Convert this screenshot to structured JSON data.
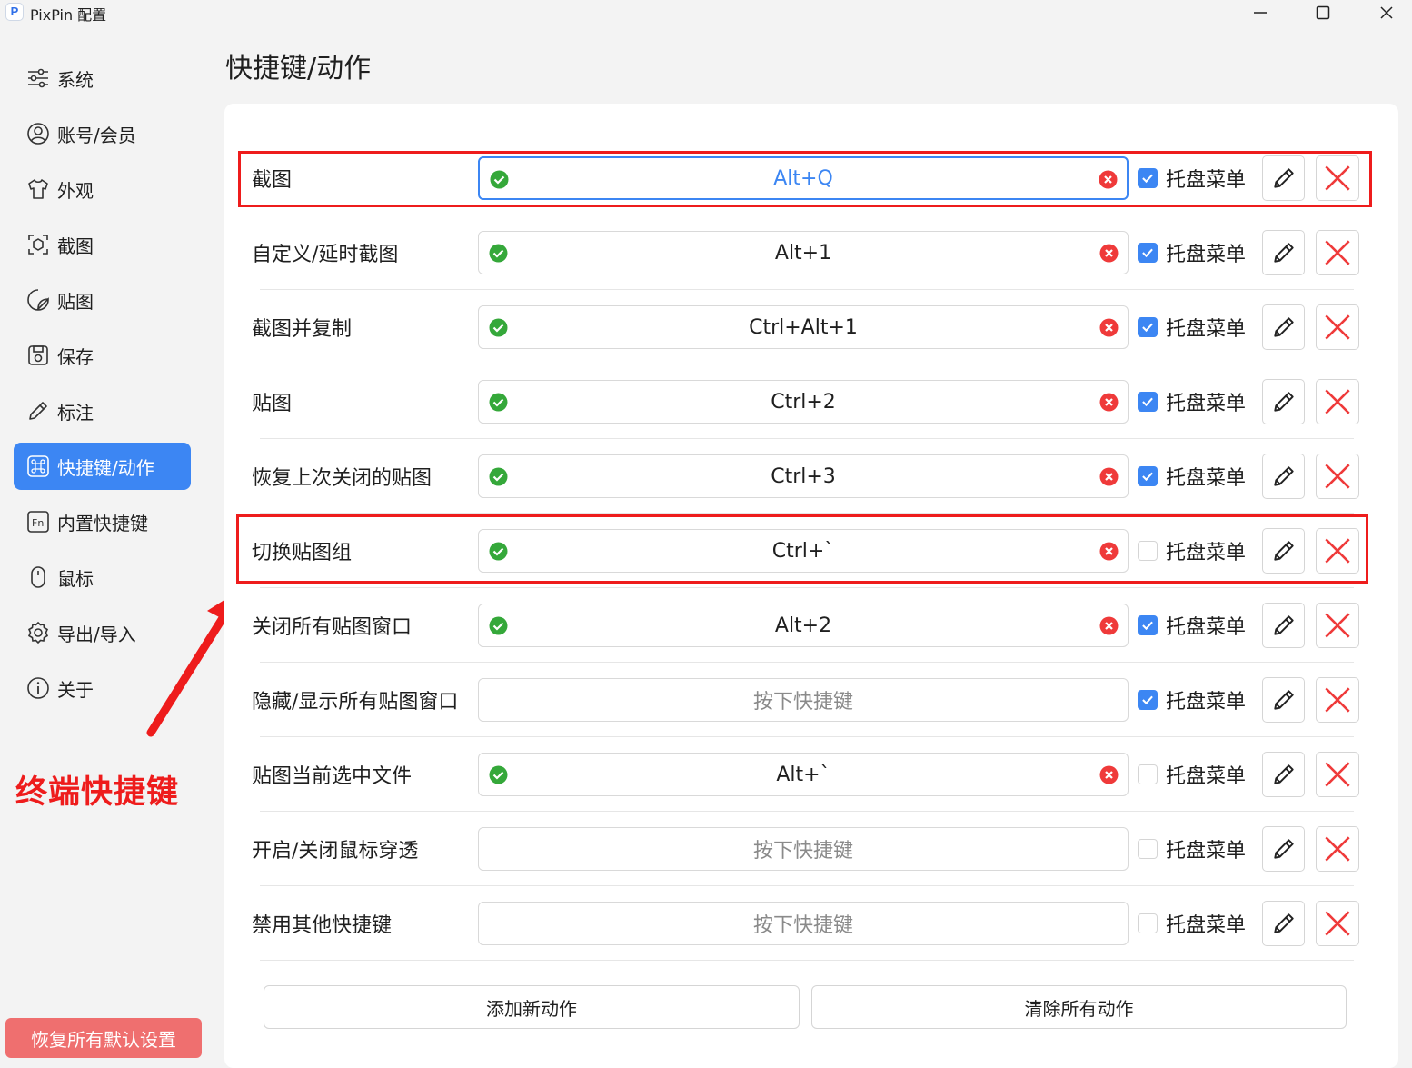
{
  "window": {
    "logo_letter": "P",
    "title": "PixPin 配置"
  },
  "sidebar": {
    "items": [
      {
        "label": "系统",
        "icon": "sliders-icon",
        "active": false
      },
      {
        "label": "账号/会员",
        "icon": "user-circle-icon",
        "active": false
      },
      {
        "label": "外观",
        "icon": "shirt-icon",
        "active": false
      },
      {
        "label": "截图",
        "icon": "screenshot-icon",
        "active": false
      },
      {
        "label": "贴图",
        "icon": "sticker-icon",
        "active": false
      },
      {
        "label": "保存",
        "icon": "save-icon",
        "active": false
      },
      {
        "label": "标注",
        "icon": "pencil-icon",
        "active": false
      },
      {
        "label": "快捷键/动作",
        "icon": "command-icon",
        "active": true
      },
      {
        "label": "内置快捷键",
        "icon": "fn-key-icon",
        "active": false
      },
      {
        "label": "鼠标",
        "icon": "mouse-icon",
        "active": false
      },
      {
        "label": "导出/导入",
        "icon": "gear-icon",
        "active": false
      },
      {
        "label": "关于",
        "icon": "info-icon",
        "active": false
      }
    ],
    "restore_label": "恢复所有默认设置"
  },
  "annotation": {
    "text": "终端快捷键",
    "color": "#ee1c1c"
  },
  "main": {
    "title": "快捷键/动作",
    "tray_label": "托盘菜单",
    "hotkey_placeholder": "按下快捷键",
    "actions": [
      {
        "name": "截图",
        "hotkey": "Alt+Q",
        "valid": true,
        "tray": true
      },
      {
        "name": "自定义/延时截图",
        "hotkey": "Alt+1",
        "valid": true,
        "tray": true
      },
      {
        "name": "截图并复制",
        "hotkey": "Ctrl+Alt+1",
        "valid": true,
        "tray": true
      },
      {
        "name": "贴图",
        "hotkey": "Ctrl+2",
        "valid": true,
        "tray": true
      },
      {
        "name": "恢复上次关闭的贴图",
        "hotkey": "Ctrl+3",
        "valid": true,
        "tray": true
      },
      {
        "name": "切换贴图组",
        "hotkey": "Ctrl+`",
        "valid": true,
        "tray": false
      },
      {
        "name": "关闭所有贴图窗口",
        "hotkey": "Alt+2",
        "valid": true,
        "tray": true
      },
      {
        "name": "隐藏/显示所有贴图窗口",
        "hotkey": "",
        "valid": false,
        "tray": true
      },
      {
        "name": "贴图当前选中文件",
        "hotkey": "Alt+`",
        "valid": true,
        "tray": false
      },
      {
        "name": "开启/关闭鼠标穿透",
        "hotkey": "",
        "valid": false,
        "tray": false
      },
      {
        "name": "禁用其他快捷键",
        "hotkey": "",
        "valid": false,
        "tray": false
      }
    ],
    "add_label": "添加新动作",
    "clear_label": "清除所有动作"
  },
  "colors": {
    "accent": "#3c86f3",
    "valid_green": "#35a83a",
    "clear_red": "#ef3a3a",
    "highlight_red": "#ee1c1c",
    "restore_bg": "#ef6f6f"
  }
}
